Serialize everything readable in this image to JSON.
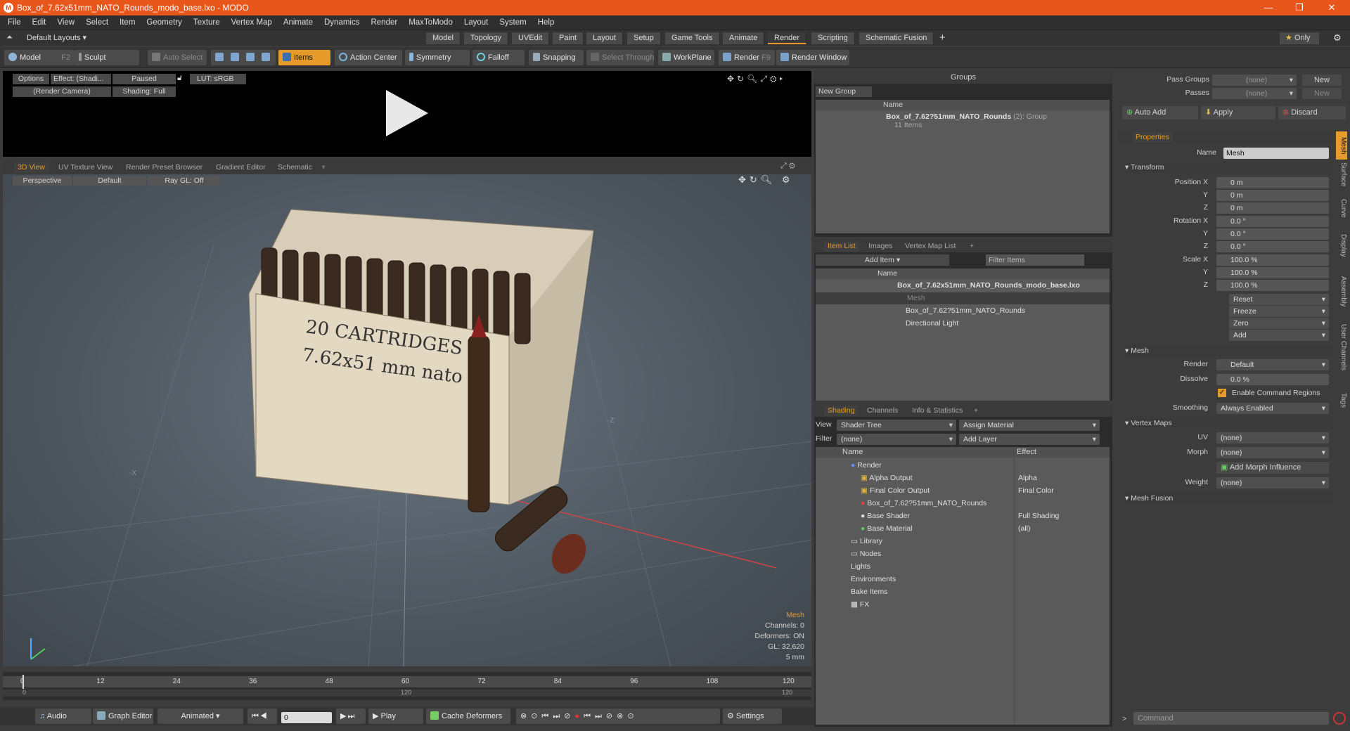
{
  "title": "Box_of_7.62x51mm_NATO_Rounds_modo_base.lxo - MODO",
  "menu": [
    "File",
    "Edit",
    "View",
    "Select",
    "Item",
    "Geometry",
    "Texture",
    "Vertex Map",
    "Animate",
    "Dynamics",
    "Render",
    "MaxToModo",
    "Layout",
    "System",
    "Help"
  ],
  "layout_dropdown": "Default Layouts ▾",
  "layout_tabs": [
    "Model",
    "Topology",
    "UVEdit",
    "Paint",
    "Layout",
    "Setup",
    "Game Tools",
    "Animate",
    "Render",
    "Scripting",
    "Schematic Fusion"
  ],
  "only_label": "Only",
  "toolbar": {
    "model": "Model",
    "model_key": "F2",
    "sculpt": "Sculpt",
    "auto_select": "Auto Select",
    "items": "Items",
    "action_center": "Action Center",
    "symmetry": "Symmetry",
    "falloff": "Falloff",
    "snapping": "Snapping",
    "select_through": "Select Through",
    "workplane": "WorkPlane",
    "render": "Render",
    "render_key": "F9",
    "render_window": "Render Window"
  },
  "preview": {
    "options": "Options",
    "effect": "Effect: (Shadi...",
    "paused": "Paused",
    "lut": "LUT: sRGB",
    "camera": "(Render Camera)",
    "shading": "Shading: Full"
  },
  "viewport_tabs": [
    "3D View",
    "UV Texture View",
    "Render Preset Browser",
    "Gradient Editor",
    "Schematic"
  ],
  "viewport": {
    "perspective": "Perspective",
    "default": "Default",
    "raygl": "Ray GL: Off",
    "box_text1": "20 CARTRIDGES",
    "box_text2": "7.62x51 mm nato",
    "axis_x": "-X",
    "axis_z": "-Z",
    "info_mesh": "Mesh",
    "info_channels": "Channels: 0",
    "info_deformers": "Deformers: ON",
    "info_gl": "GL: 32,620",
    "info_scale": "5 mm"
  },
  "timeline": {
    "ticks": [
      "0",
      "12",
      "24",
      "36",
      "48",
      "60",
      "72",
      "84",
      "96",
      "108",
      "120"
    ],
    "ticks2": [
      "0",
      "120",
      "120"
    ]
  },
  "bottom": {
    "audio": "Audio",
    "graph": "Graph Editor",
    "animated": "Animated",
    "frame": "0",
    "play": "Play",
    "cache": "Cache Deformers",
    "settings": "Settings"
  },
  "groups": {
    "title": "Groups",
    "new_group": "New Group",
    "col_name": "Name",
    "item": "Box_of_7.62?51mm_NATO_Rounds",
    "item_count": "(2)",
    "item_type": ": Group",
    "item_sub": "11 Items"
  },
  "itemlist": {
    "tabs": [
      "Item List",
      "Images",
      "Vertex Map List"
    ],
    "add_item": "Add Item",
    "filter": "Filter Items",
    "col_name": "Name",
    "rows": [
      "Box_of_7.62x51mm_NATO_Rounds_modo_base.lxo",
      "Mesh",
      "Box_of_7.62?51mm_NATO_Rounds",
      "Directional Light"
    ]
  },
  "shading": {
    "tabs": [
      "Shading",
      "Channels",
      "Info & Statistics"
    ],
    "view_label": "View",
    "view_value": "Shader Tree",
    "assign": "Assign Material",
    "filter_label": "Filter",
    "filter_value": "(none)",
    "add_layer": "Add Layer",
    "col_name": "Name",
    "col_effect": "Effect",
    "rows": [
      {
        "name": "Render",
        "effect": ""
      },
      {
        "name": "Alpha Output",
        "effect": "Alpha"
      },
      {
        "name": "Final Color Output",
        "effect": "Final Color"
      },
      {
        "name": "Box_of_7.62?51mm_NATO_Rounds",
        "effect": ""
      },
      {
        "name": "Base Shader",
        "effect": "Full Shading"
      },
      {
        "name": "Base Material",
        "effect": "(all)"
      },
      {
        "name": "Library",
        "effect": ""
      },
      {
        "name": "Nodes",
        "effect": ""
      },
      {
        "name": "Lights",
        "effect": ""
      },
      {
        "name": "Environments",
        "effect": ""
      },
      {
        "name": "Bake Items",
        "effect": ""
      },
      {
        "name": "FX",
        "effect": ""
      }
    ]
  },
  "props": {
    "pass_groups": "Pass Groups",
    "passes": "Passes",
    "none": "(none)",
    "new": "New",
    "auto_add": "Auto Add",
    "apply": "Apply",
    "discard": "Discard",
    "tab": "Properties",
    "name_label": "Name",
    "name_value": "Mesh",
    "transform": "Transform",
    "pos_labels": [
      "Position X",
      "Y",
      "Z"
    ],
    "pos_values": [
      "0 m",
      "0 m",
      "0 m"
    ],
    "rot_labels": [
      "Rotation X",
      "Y",
      "Z"
    ],
    "rot_values": [
      "0.0 °",
      "0.0 °",
      "0.0 °"
    ],
    "scale_labels": [
      "Scale X",
      "Y",
      "Z"
    ],
    "scale_values": [
      "100.0 %",
      "100.0 %",
      "100.0 %"
    ],
    "actions": [
      "Reset",
      "Freeze",
      "Zero",
      "Add"
    ],
    "mesh": "Mesh",
    "render_label": "Render",
    "render_value": "Default",
    "dissolve_label": "Dissolve",
    "dissolve_value": "0.0 %",
    "enable_cmd": "Enable Command Regions",
    "smoothing_label": "Smoothing",
    "smoothing_value": "Always Enabled",
    "vertex_maps": "Vertex Maps",
    "uv_label": "UV",
    "morph_label": "Morph",
    "add_morph": "Add Morph Influence",
    "weight_label": "Weight",
    "mesh_fusion": "Mesh Fusion",
    "command": "Command",
    "vtabs": [
      "Mesh",
      "Surface",
      "Curve",
      "Display",
      "Assembly",
      "User Channels",
      "Tags"
    ]
  },
  "colors": {
    "accent": "#e69a2a",
    "titlebar": "#e8561c"
  }
}
